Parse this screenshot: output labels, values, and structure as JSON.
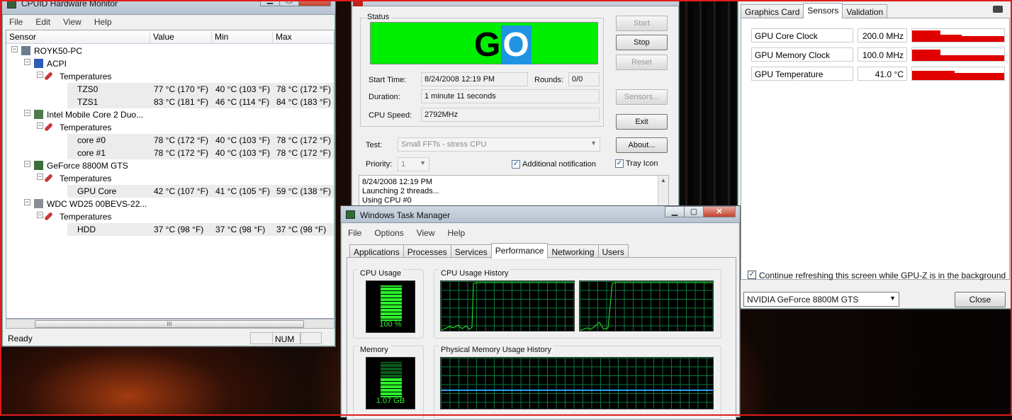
{
  "hwmonitor": {
    "title": "CPUID Hardware Monitor",
    "menu": [
      "File",
      "Edit",
      "View",
      "Help"
    ],
    "columns": [
      "Sensor",
      "Value",
      "Min",
      "Max"
    ],
    "rows": [
      {
        "name": "ROYK50-PC",
        "value": "",
        "min": "",
        "max": "",
        "level": 0,
        "icon": "computer-icon"
      },
      {
        "name": "ACPI",
        "value": "",
        "min": "",
        "max": "",
        "level": 1,
        "icon": "acpi-shield-icon"
      },
      {
        "name": "Temperatures",
        "value": "",
        "min": "",
        "max": "",
        "level": 2,
        "icon": "thermometer-icon"
      },
      {
        "name": "TZS0",
        "value": "77 °C  (170 °F)",
        "min": "40 °C  (103 °F)",
        "max": "78 °C  (172 °F)",
        "level": 3,
        "icon": ""
      },
      {
        "name": "TZS1",
        "value": "83 °C  (181 °F)",
        "min": "46 °C  (114 °F)",
        "max": "84 °C  (183 °F)",
        "level": 3,
        "icon": ""
      },
      {
        "name": "Intel Mobile Core 2 Duo...",
        "value": "",
        "min": "",
        "max": "",
        "level": 1,
        "icon": "cpu-chip-icon"
      },
      {
        "name": "Temperatures",
        "value": "",
        "min": "",
        "max": "",
        "level": 2,
        "icon": "thermometer-icon"
      },
      {
        "name": "core #0",
        "value": "78 °C  (172 °F)",
        "min": "40 °C  (103 °F)",
        "max": "78 °C  (172 °F)",
        "level": 3,
        "icon": ""
      },
      {
        "name": "core #1",
        "value": "78 °C  (172 °F)",
        "min": "40 °C  (103 °F)",
        "max": "78 °C  (172 °F)",
        "level": 3,
        "icon": ""
      },
      {
        "name": "GeForce 8800M GTS",
        "value": "",
        "min": "",
        "max": "",
        "level": 1,
        "icon": "graphics-card-icon"
      },
      {
        "name": "Temperatures",
        "value": "",
        "min": "",
        "max": "",
        "level": 2,
        "icon": "thermometer-icon"
      },
      {
        "name": "GPU Core",
        "value": "42 °C  (107 °F)",
        "min": "41 °C  (105 °F)",
        "max": "59 °C  (138 °F)",
        "level": 3,
        "icon": ""
      },
      {
        "name": "WDC WD25 00BEVS-22...",
        "value": "",
        "min": "",
        "max": "",
        "level": 1,
        "icon": "hard-drive-icon"
      },
      {
        "name": "Temperatures",
        "value": "",
        "min": "",
        "max": "",
        "level": 2,
        "icon": "thermometer-icon"
      },
      {
        "name": "HDD",
        "value": "37 °C  (98 °F)",
        "min": "37 °C  (98 °F)",
        "max": "37 °C  (98 °F)",
        "level": 3,
        "icon": ""
      }
    ],
    "scroll_grip": "III",
    "status": "Ready",
    "num": "NUM"
  },
  "prime95": {
    "status_label": "Status",
    "go_g": "G",
    "go_o": "O",
    "start_time_label": "Start Time:",
    "start_time": "8/24/2008 12:19 PM",
    "rounds_label": "Rounds:",
    "rounds": "0/0",
    "duration_label": "Duration:",
    "duration": "1 minute 11 seconds",
    "cpu_speed_label": "CPU Speed:",
    "cpu_speed": "2792MHz",
    "test_label": "Test:",
    "test_value": "Small FFTs - stress CPU",
    "priority_label": "Priority:",
    "priority_value": "1",
    "additional_notification": "Additional notification",
    "tray_icon": "Tray Icon",
    "buttons": {
      "start": "Start",
      "stop": "Stop",
      "reset": "Reset",
      "sensors": "Sensors...",
      "exit": "Exit",
      "about": "About..."
    },
    "log": [
      "8/24/2008 12:19 PM",
      "Launching 2 threads...",
      "Using CPU #0"
    ],
    "accent_colors": {
      "go_green": "#00ee00",
      "go_blue": "#1f94e3"
    }
  },
  "gpuz": {
    "tabs": [
      "Graphics Card",
      "Sensors",
      "Validation"
    ],
    "active_tab": "Sensors",
    "sensors": [
      {
        "name": "GPU Core Clock",
        "value": "200.0 MHz"
      },
      {
        "name": "GPU Memory Clock",
        "value": "100.0 MHz"
      },
      {
        "name": "GPU Temperature",
        "value": "41.0 °C"
      }
    ],
    "refresh_label": "Continue refreshing this screen while GPU-Z is in the background",
    "device": "NVIDIA GeForce 8800M GTS",
    "close": "Close",
    "graph_color": "#e00000"
  },
  "taskmanager": {
    "title": "Windows Task Manager",
    "menu": [
      "File",
      "Options",
      "View",
      "Help"
    ],
    "tabs": [
      "Applications",
      "Processes",
      "Services",
      "Performance",
      "Networking",
      "Users"
    ],
    "active_tab": "Performance",
    "cpu_usage_label": "CPU Usage",
    "cpu_usage_value": "100 %",
    "cpu_usage_fraction": 1.0,
    "cpu_history_label": "CPU Usage History",
    "memory_label": "Memory",
    "memory_value": "1.07 GB",
    "memory_fraction": 0.55,
    "physical_memory_label": "Physical Memory Usage History",
    "graph_colors": {
      "line": "#2bf22b",
      "memory_line": "#2a9df4",
      "grid": "#0a7a3a"
    }
  }
}
